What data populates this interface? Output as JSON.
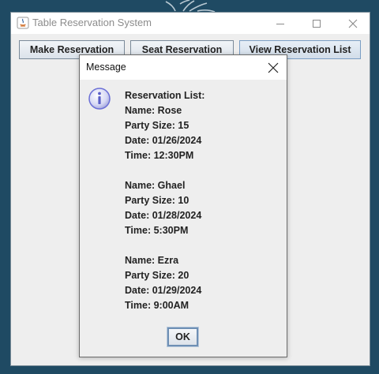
{
  "window": {
    "title": "Table Reservation System"
  },
  "toolbar": {
    "make_label": "Make Reservation",
    "seat_label": "Seat Reservation",
    "view_label": "View Reservation List"
  },
  "dialog": {
    "title": "Message",
    "icon": "info-icon",
    "ok_label": "OK",
    "lines": [
      "Reservation List:",
      "Name: Rose",
      "Party Size: 15",
      "Date: 01/26/2024",
      "Time: 12:30PM",
      "",
      "Name: Ghael",
      "Party Size: 10",
      "Date: 01/28/2024",
      "Time: 5:30PM",
      "",
      "Name: Ezra",
      "Party Size: 20",
      "Date: 01/29/2024",
      "Time: 9:00AM"
    ]
  },
  "colors": {
    "desktop": "#1f4a63",
    "window_bg": "#eeeeee",
    "info_icon": "#6b6fd6"
  }
}
